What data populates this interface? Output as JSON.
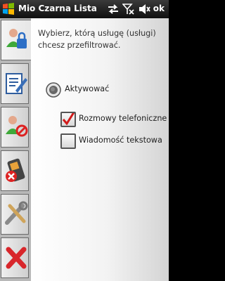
{
  "titlebar": {
    "title": "Mio Czarna Lista",
    "ok_label": "ok",
    "icons": [
      "start-logo-icon",
      "sync-icon",
      "signal-off-icon",
      "speaker-icon"
    ]
  },
  "sidebar": {
    "items": [
      {
        "name": "block-user-icon",
        "active": true
      },
      {
        "name": "edit-list-icon",
        "active": false
      },
      {
        "name": "user-blocked-icon",
        "active": false
      },
      {
        "name": "phone-delete-icon",
        "active": false
      },
      {
        "name": "tools-icon",
        "active": false
      },
      {
        "name": "close-icon",
        "active": false
      }
    ]
  },
  "content": {
    "instruction": "Wybierz, którą usługę (usługi) chcesz przefiltrować.",
    "activate_label": "Aktywować",
    "options": [
      {
        "label": "Rozmowy telefoniczne",
        "checked": true
      },
      {
        "label": "Wiadomość tekstowa",
        "checked": false
      }
    ]
  },
  "colors": {
    "check_mark": "#d11a1a",
    "title_bg": "#1a1a1a"
  }
}
